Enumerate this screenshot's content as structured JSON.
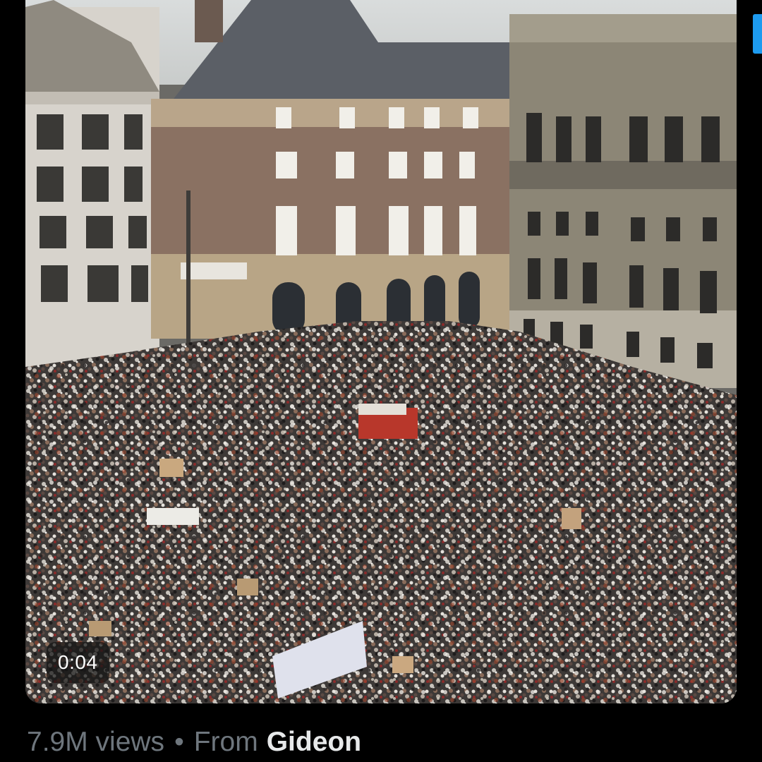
{
  "video": {
    "description_icon": "video-frame",
    "timestamp": "0:04"
  },
  "meta": {
    "views": "7.9M views",
    "separator": "•",
    "from_label": "From",
    "author": "Gideon"
  },
  "colors": {
    "background": "#000000",
    "meta_text": "#6e767d",
    "author_text": "#e7e9ea",
    "accent": "#1d9bf0",
    "timestamp_bg": "#141414"
  }
}
